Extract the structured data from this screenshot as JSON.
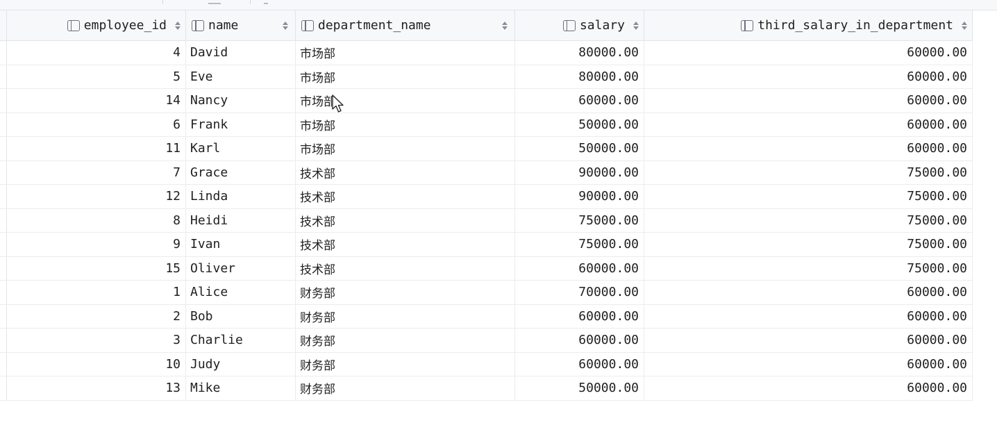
{
  "columns": {
    "employee_id": "employee_id",
    "name": "name",
    "department_name": "department_name",
    "salary": "salary",
    "third_salary": "third_salary_in_department"
  },
  "rows": [
    {
      "employee_id": "4",
      "name": "David",
      "department_name": "市场部",
      "salary": "80000.00",
      "third_salary": "60000.00"
    },
    {
      "employee_id": "5",
      "name": "Eve",
      "department_name": "市场部",
      "salary": "80000.00",
      "third_salary": "60000.00"
    },
    {
      "employee_id": "14",
      "name": "Nancy",
      "department_name": "市场部",
      "salary": "60000.00",
      "third_salary": "60000.00"
    },
    {
      "employee_id": "6",
      "name": "Frank",
      "department_name": "市场部",
      "salary": "50000.00",
      "third_salary": "60000.00"
    },
    {
      "employee_id": "11",
      "name": "Karl",
      "department_name": "市场部",
      "salary": "50000.00",
      "third_salary": "60000.00"
    },
    {
      "employee_id": "7",
      "name": "Grace",
      "department_name": "技术部",
      "salary": "90000.00",
      "third_salary": "75000.00"
    },
    {
      "employee_id": "12",
      "name": "Linda",
      "department_name": "技术部",
      "salary": "90000.00",
      "third_salary": "75000.00"
    },
    {
      "employee_id": "8",
      "name": "Heidi",
      "department_name": "技术部",
      "salary": "75000.00",
      "third_salary": "75000.00"
    },
    {
      "employee_id": "9",
      "name": "Ivan",
      "department_name": "技术部",
      "salary": "75000.00",
      "third_salary": "75000.00"
    },
    {
      "employee_id": "15",
      "name": "Oliver",
      "department_name": "技术部",
      "salary": "60000.00",
      "third_salary": "75000.00"
    },
    {
      "employee_id": "1",
      "name": "Alice",
      "department_name": "财务部",
      "salary": "70000.00",
      "third_salary": "60000.00"
    },
    {
      "employee_id": "2",
      "name": "Bob",
      "department_name": "财务部",
      "salary": "60000.00",
      "third_salary": "60000.00"
    },
    {
      "employee_id": "3",
      "name": "Charlie",
      "department_name": "财务部",
      "salary": "60000.00",
      "third_salary": "60000.00"
    },
    {
      "employee_id": "10",
      "name": "Judy",
      "department_name": "财务部",
      "salary": "60000.00",
      "third_salary": "60000.00"
    },
    {
      "employee_id": "13",
      "name": "Mike",
      "department_name": "财务部",
      "salary": "50000.00",
      "third_salary": "60000.00"
    }
  ],
  "icons": {
    "column_icon": "column-icon",
    "sort_icon": "sort-arrows-icon",
    "cursor": "mouse-cursor-icon"
  },
  "colors": {
    "header_bg": "#f7f8fa",
    "grid_line": "#ebecf0",
    "icon": "#6c707e"
  }
}
